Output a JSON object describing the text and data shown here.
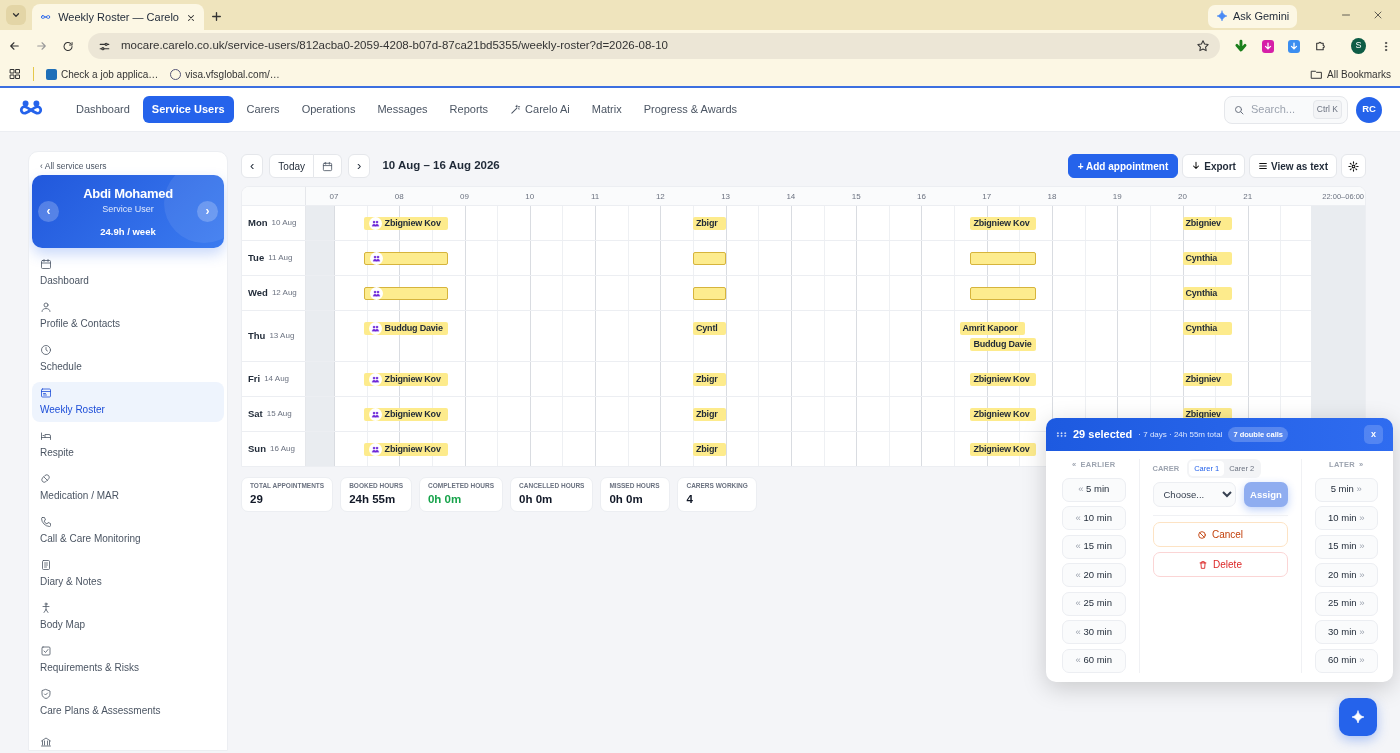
{
  "browser": {
    "tab_title": "Weekly Roster — Carelo",
    "url": "mocare.carelo.co.uk/service-users/812acba0-2059-4208-b07d-87ca21bd5355/weekly-roster?d=2026-08-10",
    "bookmarks": [
      "Check a job applica…",
      "visa.vfsglobal.com/…"
    ],
    "ask": "Ask Gemini",
    "all_bookmarks": "All Bookmarks",
    "profile": "S"
  },
  "nav": {
    "items": [
      {
        "label": "Dashboard",
        "selected": false,
        "kind": "plain"
      },
      {
        "label": "Service Users",
        "selected": true,
        "kind": "plain"
      },
      {
        "label": "Carers",
        "selected": false,
        "kind": "plain"
      },
      {
        "label": "Operations",
        "selected": false,
        "kind": "plain"
      },
      {
        "label": "Messages",
        "selected": false,
        "kind": "plain"
      },
      {
        "label": "Reports",
        "selected": false,
        "kind": "plain"
      },
      {
        "label": "Carelo Ai",
        "selected": false,
        "kind": "magic"
      },
      {
        "label": "Matrix",
        "selected": false,
        "kind": "plain"
      },
      {
        "label": "Progress & Awards",
        "selected": false,
        "kind": "plain"
      }
    ],
    "search": {
      "placeholder": "Search...",
      "shortcut": "Ctrl K"
    },
    "avatar": "RC"
  },
  "sidebar": {
    "back": "‹ All service users",
    "profile": {
      "name": "Abdi Mohamed",
      "role": "Service User",
      "hours": "24.9h / week",
      "prev": "‹",
      "next": "›"
    },
    "items": [
      {
        "label": "Dashboard",
        "selected": false
      },
      {
        "label": "Profile & Contacts",
        "selected": false
      },
      {
        "label": "Schedule",
        "selected": false
      },
      {
        "label": "Weekly Roster",
        "selected": true
      },
      {
        "label": "Respite",
        "selected": false
      },
      {
        "label": "Medication / MAR",
        "selected": false
      },
      {
        "label": "Call & Care Monitoring",
        "selected": false
      },
      {
        "label": "Diary & Notes",
        "selected": false
      },
      {
        "label": "Body Map",
        "selected": false
      },
      {
        "label": "Requirements & Risks",
        "selected": false
      },
      {
        "label": "Care Plans & Assessments",
        "selected": false
      }
    ]
  },
  "toolbar": {
    "prev": "‹",
    "today": "Today",
    "next": "›",
    "range": "10 Aug – 16 Aug 2026",
    "add": "+ Add appointment",
    "export": "Export",
    "view_text": "View as text"
  },
  "roster": {
    "hours": [
      "07",
      "08",
      "09",
      "10",
      "11",
      "12",
      "13",
      "14",
      "15",
      "16",
      "17",
      "18",
      "19",
      "20",
      "21"
    ],
    "night": "22:00–06:00",
    "days": [
      {
        "day": "Mon",
        "date": "10 Aug",
        "appointments": [
          {
            "start": {
              "level": 0.0333
            },
            "end": {
              "level": 0.1167
            },
            "carer": "Zbigniew Kov",
            "double": true
          },
          {
            "start": {
              "level": 0.3667
            },
            "end": {
              "level": 0.4
            },
            "carer": "Zbigr",
            "double": false
          },
          {
            "start": {
              "level": 0.65
            },
            "end": {
              "level": 0.7167
            },
            "carer": "Zbigniew Kov",
            "double": false
          },
          {
            "start": {
              "level": 0.8667
            },
            "end": {
              "level": 0.9167
            },
            "carer": "Zbigniev",
            "double": false
          }
        ]
      },
      {
        "day": "Tue",
        "date": "11 Aug",
        "appointments": [
          {
            "start": {
              "level": 0.0333
            },
            "end": {
              "level": 0.1167
            },
            "double": true
          },
          {
            "start": {
              "level": 0.3667
            },
            "end": {
              "level": 0.4
            },
            "double": false
          },
          {
            "start": {
              "level": 0.65
            },
            "end": {
              "level": 0.7167
            },
            "double": false
          },
          {
            "start": {
              "level": 0.8667
            },
            "end": {
              "level": 0.9167
            },
            "carer": "Cynthia",
            "double": false
          }
        ]
      },
      {
        "day": "Wed",
        "date": "12 Aug",
        "appointments": [
          {
            "start": {
              "level": 0.0333
            },
            "end": {
              "level": 0.1167
            },
            "double": true
          },
          {
            "start": {
              "level": 0.3667
            },
            "end": {
              "level": 0.4
            },
            "double": false
          },
          {
            "start": {
              "level": 0.65
            },
            "end": {
              "level": 0.7167
            },
            "double": false
          },
          {
            "start": {
              "level": 0.8667
            },
            "end": {
              "level": 0.9167
            },
            "carer": "Cynthia",
            "double": false
          }
        ]
      },
      {
        "day": "Thu",
        "date": "13 Aug",
        "appointments": [
          {
            "start": {
              "level": 0.0333
            },
            "end": {
              "level": 0.1167
            },
            "carer": "Buddug Davie",
            "double": true
          },
          {
            "start": {
              "level": 0.3667
            },
            "end": {
              "level": 0.4
            },
            "carer": "Cyntl",
            "double": false
          },
          {
            "start": {
              "level": 0.6389
            },
            "end": {
              "level": 0.7056
            },
            "carer": "Amrit Kapoor",
            "double": false
          },
          {
            "start": {
              "level": 0.65
            },
            "end": {
              "level": 0.7167
            },
            "carer": "Buddug Davie",
            "double": false
          },
          {
            "start": {
              "level": 0.8667
            },
            "end": {
              "level": 0.9167
            },
            "carer": "Cynthia",
            "double": false
          }
        ]
      },
      {
        "day": "Fri",
        "date": "14 Aug",
        "appointments": [
          {
            "start": {
              "level": 0.0333
            },
            "end": {
              "level": 0.1167
            },
            "carer": "Zbigniew Kov",
            "double": true
          },
          {
            "start": {
              "level": 0.3667
            },
            "end": {
              "level": 0.4
            },
            "carer": "Zbigr",
            "double": false
          },
          {
            "start": {
              "level": 0.65
            },
            "end": {
              "level": 0.7167
            },
            "carer": "Zbigniew Kov",
            "double": false
          },
          {
            "start": {
              "level": 0.8667
            },
            "end": {
              "level": 0.9167
            },
            "carer": "Zbigniev",
            "double": false
          }
        ]
      },
      {
        "day": "Sat",
        "date": "15 Aug",
        "appointments": [
          {
            "start": {
              "level": 0.0333
            },
            "end": {
              "level": 0.1167
            },
            "carer": "Zbigniew Kov",
            "double": true
          },
          {
            "start": {
              "level": 0.3667
            },
            "end": {
              "level": 0.4
            },
            "carer": "Zbigr",
            "double": false
          },
          {
            "start": {
              "level": 0.65
            },
            "end": {
              "level": 0.7167
            },
            "carer": "Zbigniew Kov",
            "double": false
          },
          {
            "start": {
              "level": 0.8667
            },
            "end": {
              "level": 0.9167
            },
            "carer": "Zbigniev",
            "double": false
          }
        ]
      },
      {
        "day": "Sun",
        "date": "16 Aug",
        "appointments": [
          {
            "start": {
              "level": 0.0333
            },
            "end": {
              "level": 0.1167
            },
            "carer": "Zbigniew Kov",
            "double": true
          },
          {
            "start": {
              "level": 0.3667
            },
            "end": {
              "level": 0.4
            },
            "carer": "Zbigr",
            "double": false
          },
          {
            "start": {
              "level": 0.65
            },
            "end": {
              "level": 0.7167
            },
            "carer": "Zbigniew Kov",
            "double": false
          }
        ]
      }
    ]
  },
  "stats": [
    {
      "label": "TOTAL APPOINTMENTS",
      "value": "29",
      "color": "#111827"
    },
    {
      "label": "BOOKED HOURS",
      "value": "24h 55m",
      "color": "#111827"
    },
    {
      "label": "COMPLETED HOURS",
      "value": "0h 0m",
      "color": "#16a34a"
    },
    {
      "label": "CANCELLED HOURS",
      "value": "0h 0m",
      "color": "#111827"
    },
    {
      "label": "MISSED HOURS",
      "value": "0h 0m",
      "color": "#111827"
    },
    {
      "label": "CARERS WORKING",
      "value": "4",
      "color": "#111827"
    }
  ],
  "selection_panel": {
    "title": "29 selected",
    "summary": "· 7 days · 24h 55m total",
    "badge": "7 double calls",
    "close": "x",
    "earlier": {
      "label": "EARLIER",
      "arrow": "«",
      "buttons": [
        "5 min",
        "10 min",
        "15 min",
        "20 min",
        "25 min",
        "30 min",
        "60 min"
      ]
    },
    "later": {
      "label": "LATER",
      "arrow": "»",
      "buttons": [
        "5 min",
        "10 min",
        "15 min",
        "20 min",
        "25 min",
        "30 min",
        "60 min"
      ]
    },
    "carer": {
      "label": "CARER",
      "tabs": [
        {
          "label": "Carer 1",
          "selected": true
        },
        {
          "label": "Carer 2",
          "selected": false
        }
      ],
      "select_value": "Choose...",
      "assign": {
        "label": "Assign",
        "disabled": true
      }
    },
    "actions": [
      {
        "label": "Cancel",
        "kind": "cancel"
      },
      {
        "label": "Delete",
        "kind": "delete"
      }
    ]
  }
}
